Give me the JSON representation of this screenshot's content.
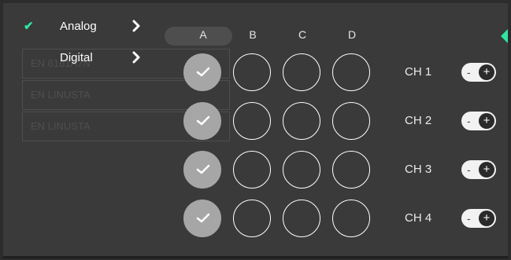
{
  "background_table": {
    "rows": [
      {
        "text": "EN 6161A7N"
      },
      {
        "text": "EN LINUSTA"
      },
      {
        "text": "EN LINUSTA"
      }
    ]
  },
  "menu": {
    "items": [
      {
        "label": "Analog",
        "selected": true,
        "check": "✔",
        "icon": "chevron-right-icon"
      },
      {
        "label": "Digital",
        "selected": false,
        "check": "",
        "icon": "chevron-right-icon"
      }
    ]
  },
  "columns": [
    "A",
    "B",
    "C",
    "D"
  ],
  "channels": [
    {
      "label": "CH 1",
      "selected_column": "A",
      "toggle_minus": "-",
      "toggle_plus": "+"
    },
    {
      "label": "CH 2",
      "selected_column": "A",
      "toggle_minus": "-",
      "toggle_plus": "+"
    },
    {
      "label": "CH 3",
      "selected_column": "A",
      "toggle_minus": "-",
      "toggle_plus": "+"
    },
    {
      "label": "CH 4",
      "selected_column": "A",
      "toggle_minus": "-",
      "toggle_plus": "+"
    }
  ],
  "colors": {
    "accent": "#2ee6a0",
    "panel": "#3a3a3a",
    "selected_circle": "#a6a6a6",
    "toggle_track": "#f2f2f2",
    "toggle_knob": "#2a2a2a"
  }
}
